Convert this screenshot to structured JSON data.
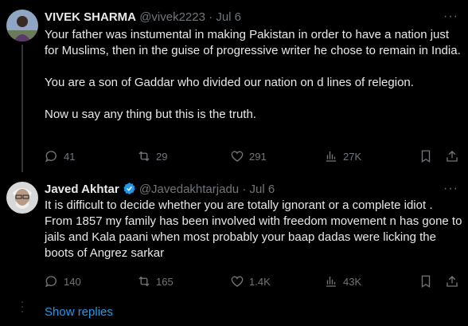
{
  "tweets": [
    {
      "name": "VIVEK SHARMA",
      "handle": "@vivek2223",
      "sep": "·",
      "date": "Jul 6",
      "paragraphs": [
        "Your father was instumental in making Pakistan in order to have a nation just for Muslims, then in the guise of progressive writer he chose to remain in India.",
        "You are a son of Gaddar who divided our nation on d lines of relegion.",
        "Now u say any thing but this is the truth."
      ],
      "replies": "41",
      "reposts": "29",
      "likes": "291",
      "views": "27K",
      "more": "···"
    },
    {
      "name": "Javed Akhtar",
      "handle": "@Javedakhtarjadu",
      "sep": "·",
      "date": "Jul 6",
      "verified": true,
      "paragraphs": [
        "It is difficult to decide whether you are totally ignorant or a complete idiot . From 1857 my family has been involved with freedom movement n has gone to jails and Kala paani when most probably your baap dadas were licking the boots of Angrez sarkar"
      ],
      "replies": "140",
      "reposts": "165",
      "likes": "1.4K",
      "views": "43K",
      "more": "···"
    }
  ],
  "show_replies": "Show replies",
  "colors": {
    "accent": "#1d9bf0",
    "muted": "#71767b",
    "text": "#e7e9ea",
    "line": "#333639"
  }
}
